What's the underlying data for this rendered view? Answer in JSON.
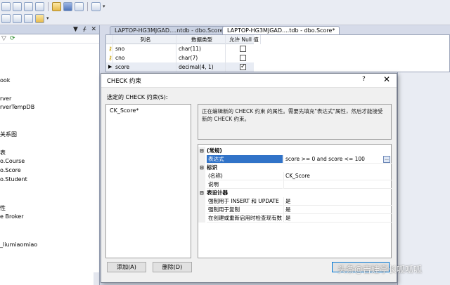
{
  "toolbar": {
    "row1_buttons": [
      "toolbar-icon-1",
      "toolbar-icon-2",
      "toolbar-icon-3",
      "new-query-icon",
      "open-folder-icon",
      "save-icon",
      "save-all-icon",
      "activity-monitor-icon"
    ],
    "row2_buttons": [
      "toolbar-icon-4",
      "toolbar-icon-5",
      "toolbar-icon-6",
      "toolbar-icon-7"
    ]
  },
  "explorer": {
    "header_icons": [
      "▼",
      "ᚋ",
      "✕"
    ],
    "tree_items": [
      {
        "label": "ook"
      },
      {
        "label": "rver"
      },
      {
        "label": "rverTempDB"
      },
      {
        "label": "关系图"
      },
      {
        "label": "表"
      },
      {
        "label": "o.Course"
      },
      {
        "label": "o.Score"
      },
      {
        "label": "o.Student"
      },
      {
        "label": "性"
      },
      {
        "label": "e Broker"
      },
      {
        "label": "_liumiaomiao"
      }
    ]
  },
  "tabs": [
    {
      "label": "LAPTOP-HG3MJGAD....ntdb - dbo.Score",
      "active": false
    },
    {
      "label": "LAPTOP-HG3MJGAD....tdb - dbo.Score*",
      "active": true
    }
  ],
  "designer": {
    "columns": [
      "列名",
      "数据类型",
      "允许 Null 值"
    ],
    "rows": [
      {
        "key": true,
        "name": "sno",
        "type": "char(11)",
        "allow_null": false
      },
      {
        "key": true,
        "name": "cno",
        "type": "char(7)",
        "allow_null": false
      },
      {
        "key": false,
        "name": "score",
        "type": "decimal(4, 1)",
        "allow_null": true
      }
    ]
  },
  "dialog": {
    "title": "CHECK 约束",
    "help": "?",
    "close": "✕",
    "selected_label": "选定的 CHECK 约束(S):",
    "constraints": [
      "CK_Score*"
    ],
    "description": "正在编辑新的 CHECK 约束 的属性。需要先填充\"表达式\"属性，然后才能接受新的 CHECK 约束。",
    "properties": [
      {
        "kind": "category",
        "toggle": "⊟",
        "label": "(常规)"
      },
      {
        "kind": "prop",
        "name": "表达式",
        "value": "score >= 0 and score <= 100",
        "selected": true,
        "button": "..."
      },
      {
        "kind": "category",
        "toggle": "⊟",
        "label": "标识"
      },
      {
        "kind": "prop",
        "name": "(名称)",
        "value": "CK_Score"
      },
      {
        "kind": "prop",
        "name": "说明",
        "value": ""
      },
      {
        "kind": "category",
        "toggle": "⊟",
        "label": "表设计器"
      },
      {
        "kind": "prop",
        "name": "强制用于 INSERT 和 UPDATE",
        "value": "是"
      },
      {
        "kind": "prop",
        "name": "强制用于复制",
        "value": "是"
      },
      {
        "kind": "prop",
        "name": "在创建或重新启用时检查现有数",
        "value": "是"
      }
    ],
    "add_button": "添加(A)",
    "delete_button": "删除(D)",
    "close_button": ""
  },
  "watermark": "头条@吉娃亭长呱呱呱"
}
